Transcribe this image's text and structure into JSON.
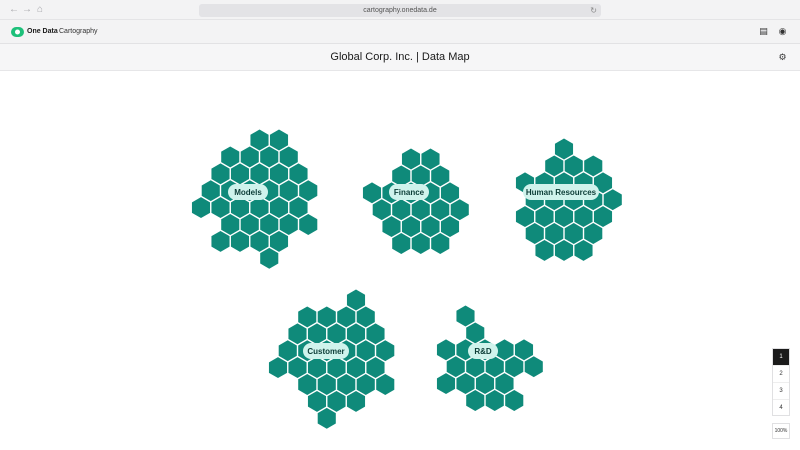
{
  "browser": {
    "url": "cartography.onedata.de"
  },
  "app": {
    "brand": "One Data",
    "name": "Cartography"
  },
  "page": {
    "title": "Global Corp. Inc. | Data Map"
  },
  "colors": {
    "hex_fill": "#0f8a7a",
    "label_fill": "#cff3ec",
    "accent": "#1ec07a"
  },
  "regions": [
    {
      "label": "Models"
    },
    {
      "label": "Finance"
    },
    {
      "label": "Human Resources"
    },
    {
      "label": "Customer"
    },
    {
      "label": "R&D"
    }
  ],
  "pager": {
    "pages": [
      "1",
      "2",
      "3",
      "4"
    ],
    "active_index": 0,
    "zoom": "100%"
  }
}
